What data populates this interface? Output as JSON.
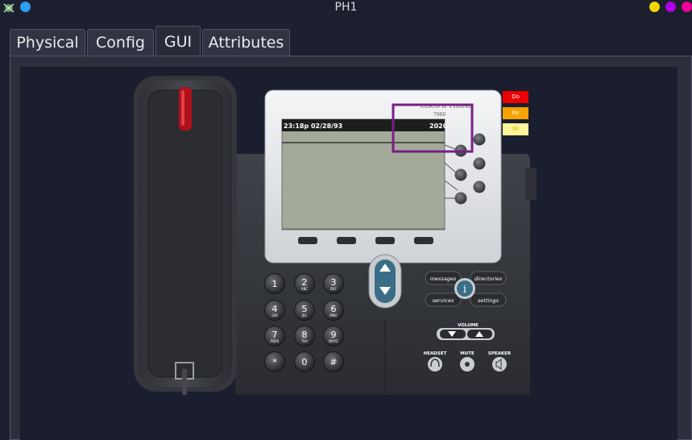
{
  "window": {
    "title": "PH1"
  },
  "tabs": [
    {
      "label": "Physical"
    },
    {
      "label": "Config"
    },
    {
      "label": "GUI"
    },
    {
      "label": "Attributes"
    }
  ],
  "phone": {
    "brand": "CISCO IP PHONE",
    "model": "7960",
    "screen": {
      "datetime": "23:18p 02/28/93",
      "extension": "2020"
    },
    "keys": [
      {
        "digit": "1",
        "letters": ""
      },
      {
        "digit": "2",
        "letters": "ABC"
      },
      {
        "digit": "3",
        "letters": "DEF"
      },
      {
        "digit": "4",
        "letters": "GHI"
      },
      {
        "digit": "5",
        "letters": "JKL"
      },
      {
        "digit": "6",
        "letters": "MNO"
      },
      {
        "digit": "7",
        "letters": "PQRS"
      },
      {
        "digit": "8",
        "letters": "TUV"
      },
      {
        "digit": "9",
        "letters": "WXYZ"
      },
      {
        "digit": "*",
        "letters": ""
      },
      {
        "digit": "0",
        "letters": ""
      },
      {
        "digit": "#",
        "letters": ""
      }
    ],
    "function_buttons": {
      "messages": "messages",
      "directories": "directories",
      "services": "services",
      "settings": "settings",
      "info": "i"
    },
    "volume_label": "VOLUME",
    "headset_label": "HEADSET",
    "mute_label": "MUTE",
    "speaker_label": "SPEAKER"
  },
  "legend": [
    {
      "label": "Do",
      "color": "#ee0000",
      "text_color": "#ffffff"
    },
    {
      "label": "Ke",
      "color": "#f5a300",
      "text_color": "#ffffff"
    },
    {
      "label": "Mi",
      "color": "#fff59a",
      "text_color": "#d8c200"
    }
  ],
  "highlight_color": "#7a1f86"
}
